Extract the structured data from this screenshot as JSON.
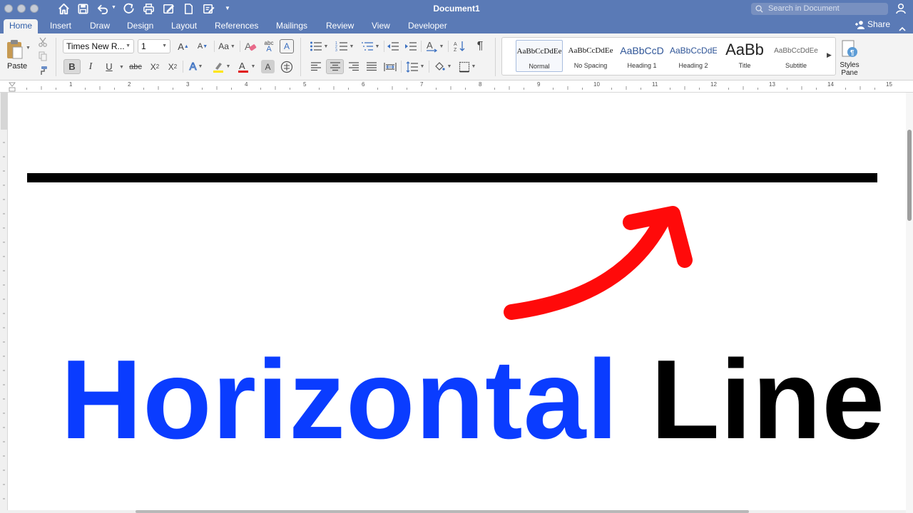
{
  "window": {
    "title": "Document1",
    "search_placeholder": "Search in Document"
  },
  "tabs": [
    {
      "label": "Home",
      "active": true
    },
    {
      "label": "Insert"
    },
    {
      "label": "Draw"
    },
    {
      "label": "Design"
    },
    {
      "label": "Layout"
    },
    {
      "label": "References"
    },
    {
      "label": "Mailings"
    },
    {
      "label": "Review"
    },
    {
      "label": "View"
    },
    {
      "label": "Developer"
    }
  ],
  "share_label": "Share",
  "ribbon": {
    "paste_label": "Paste",
    "font_name": "Times New R...",
    "font_size": "1",
    "bold": "B",
    "italic": "I",
    "underline": "U",
    "strikethrough": "abc",
    "subscript": "X",
    "subscript_mark": "2",
    "superscript": "X",
    "superscript_mark": "2",
    "grow_font": "A",
    "shrink_font": "A",
    "change_case": "Aa",
    "phonetic": "abc",
    "pilcrow": "¶",
    "styles": [
      {
        "preview": "AaBbCcDdEe",
        "name": "Normal",
        "selected": true
      },
      {
        "preview": "AaBbCcDdEe",
        "name": "No Spacing"
      },
      {
        "preview": "AaBbCcD",
        "name": "Heading 1"
      },
      {
        "preview": "AaBbCcDdE",
        "name": "Heading 2"
      },
      {
        "preview": "AaBb",
        "name": "Title"
      },
      {
        "preview": "AaBbCcDdEe",
        "name": "Subtitle"
      }
    ],
    "styles_pane_label_1": "Styles",
    "styles_pane_label_2": "Pane"
  },
  "ruler_numbers": [
    "1",
    "2",
    "3",
    "4",
    "5",
    "6",
    "7",
    "8",
    "9",
    "10",
    "11",
    "12",
    "13",
    "14",
    "15"
  ],
  "document": {
    "text_blue": "Horizontal",
    "text_black": "Line"
  },
  "colors": {
    "title_bar": "#5a7ab6",
    "ribbon_bg": "#f3f3f3",
    "accent_tab_text": "#2f5ea8",
    "big_text_blue": "#0a3cff",
    "arrow_red": "#ff0a0a",
    "line_black": "#000000"
  }
}
